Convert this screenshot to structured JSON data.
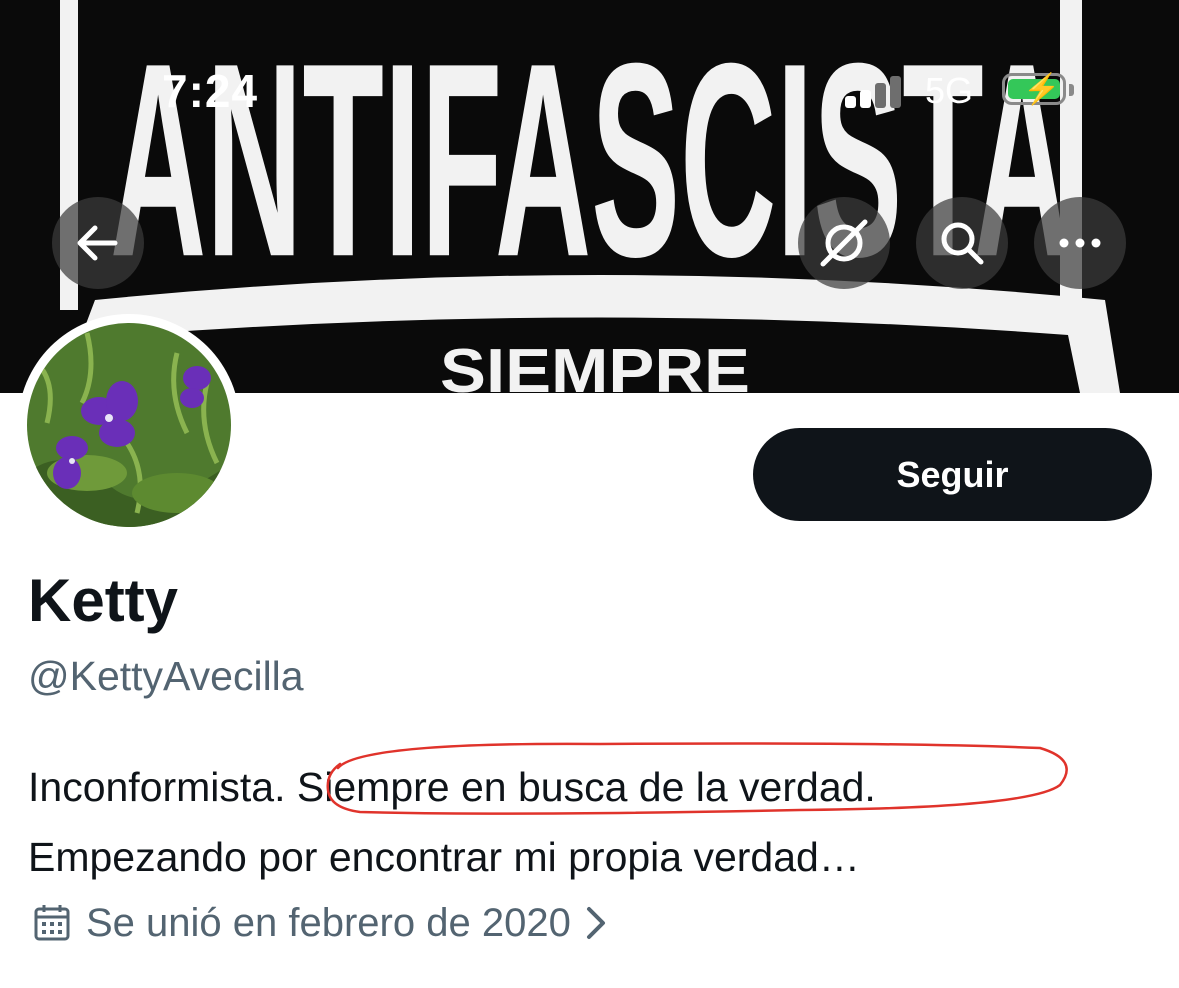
{
  "status_bar": {
    "time": "7:24",
    "network": "5G",
    "signal_bars_active": 2,
    "signal_bars_total": 4,
    "battery_charging": true
  },
  "header": {
    "banner_text_top": "ANTIFASCISTA",
    "banner_text_bottom": "SIEMPRE",
    "back_icon": "back-arrow-icon",
    "icons": [
      "grok-icon",
      "search-icon",
      "more-icon"
    ]
  },
  "profile": {
    "follow_label": "Seguir",
    "name": "Ketty",
    "handle": "@KettyAvecilla",
    "bio_line1_start": "Inconformista",
    "bio_line1_period": ".",
    "bio_line1_highlight": " Siempre en busca de la verdad.",
    "bio_line2": "Empezando por encontrar mi propia verdad…",
    "joined": "Se unió en febrero de 2020",
    "joined_icon": "calendar-icon"
  },
  "colors": {
    "primary_text": "#0f1419",
    "secondary_text": "#536471",
    "follow_bg": "#0f1419",
    "annotation": "#e0332b",
    "battery": "#34c759"
  }
}
